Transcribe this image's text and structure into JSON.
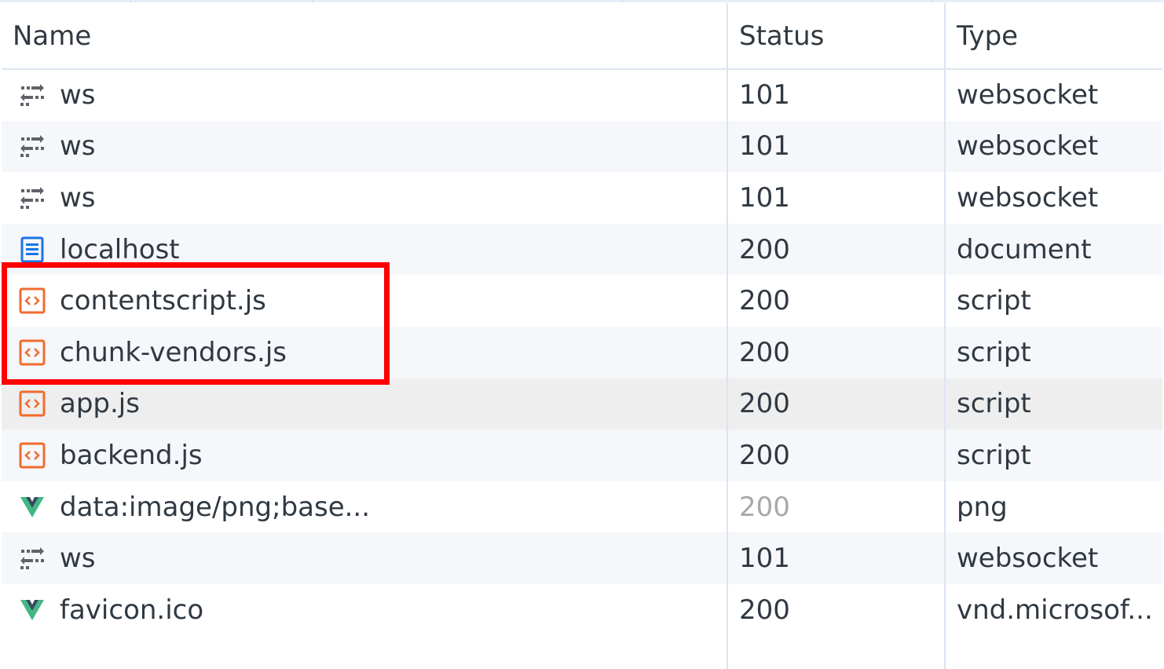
{
  "columns": {
    "name": "Name",
    "status": "Status",
    "type": "Type"
  },
  "rows": [
    {
      "icon": "websocket-icon",
      "name": "ws",
      "status": "101",
      "type": "websocket"
    },
    {
      "icon": "websocket-icon",
      "name": "ws",
      "status": "101",
      "type": "websocket"
    },
    {
      "icon": "websocket-icon",
      "name": "ws",
      "status": "101",
      "type": "websocket"
    },
    {
      "icon": "document-icon",
      "name": "localhost",
      "status": "200",
      "type": "document"
    },
    {
      "icon": "script-icon",
      "name": "contentscript.js",
      "status": "200",
      "type": "script"
    },
    {
      "icon": "script-icon",
      "name": "chunk-vendors.js",
      "status": "200",
      "type": "script"
    },
    {
      "icon": "script-icon",
      "name": "app.js",
      "status": "200",
      "type": "script"
    },
    {
      "icon": "script-icon",
      "name": "backend.js",
      "status": "200",
      "type": "script"
    },
    {
      "icon": "vue-logo-icon",
      "name": "data:image/png;base...",
      "status": "200",
      "type": "png"
    },
    {
      "icon": "websocket-icon",
      "name": "ws",
      "status": "101",
      "type": "websocket"
    },
    {
      "icon": "vue-logo-icon",
      "name": "favicon.ico",
      "status": "200",
      "type": "vnd.microsof..."
    }
  ],
  "colors": {
    "highlight": "#ff0000",
    "script_icon": "#f26b2f",
    "document_icon": "#1a73e8",
    "vue_icon": "#41b883"
  }
}
